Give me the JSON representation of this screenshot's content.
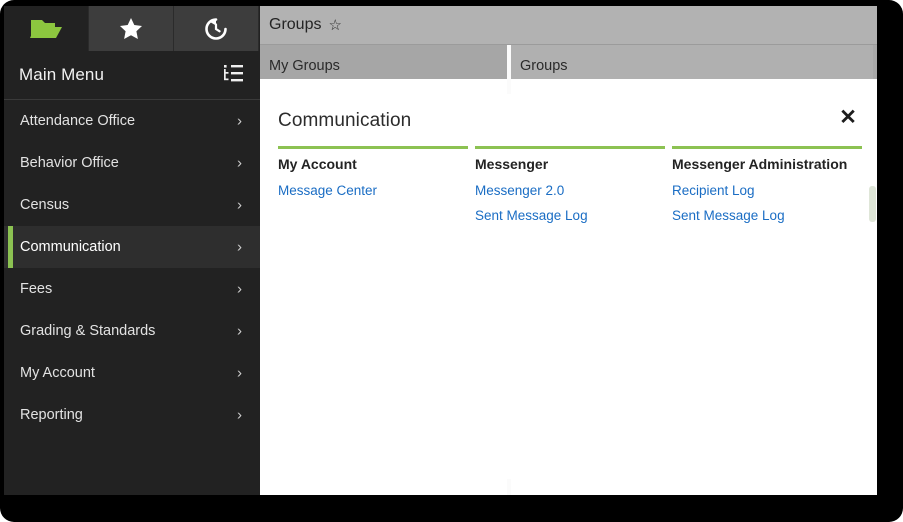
{
  "colors": {
    "accent_green": "#8cc252",
    "link_blue": "#1a6dc4",
    "sidebar_bg": "#222222",
    "sidebar_selected_bg": "#2e2e2e",
    "content_gray": "#b0b0b0"
  },
  "sidebar": {
    "tabs": [
      {
        "name": "folder-tab",
        "icon": "folder-icon",
        "active": true
      },
      {
        "name": "favorites-tab",
        "icon": "star-icon",
        "active": false
      },
      {
        "name": "history-tab",
        "icon": "history-icon",
        "active": false
      }
    ],
    "header": {
      "title": "Main Menu",
      "tree_icon": "tree-list-icon"
    },
    "items": [
      {
        "label": "Attendance Office",
        "selected": false
      },
      {
        "label": "Behavior Office",
        "selected": false
      },
      {
        "label": "Census",
        "selected": false
      },
      {
        "label": "Communication",
        "selected": true
      },
      {
        "label": "Fees",
        "selected": false
      },
      {
        "label": "Grading & Standards",
        "selected": false
      },
      {
        "label": "My Account",
        "selected": false
      },
      {
        "label": "Reporting",
        "selected": false
      }
    ],
    "chevron": "›"
  },
  "page": {
    "title": "Groups",
    "favorite_icon": "☆",
    "panels": [
      {
        "label": "My Groups"
      },
      {
        "label": "Groups"
      }
    ]
  },
  "modal": {
    "title": "Communication",
    "close_label": "✕",
    "columns": [
      {
        "heading": "My Account",
        "links": [
          {
            "label": "Message Center"
          }
        ]
      },
      {
        "heading": "Messenger",
        "links": [
          {
            "label": "Messenger 2.0"
          },
          {
            "label": "Sent Message Log"
          }
        ]
      },
      {
        "heading": "Messenger Administration",
        "links": [
          {
            "label": "Recipient Log"
          },
          {
            "label": "Sent Message Log"
          }
        ]
      }
    ]
  }
}
